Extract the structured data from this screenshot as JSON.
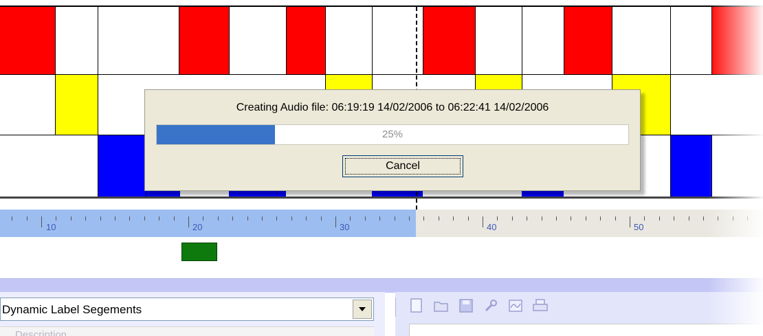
{
  "colors": {
    "red": "#ff0000",
    "yellow": "#ffff00",
    "blue": "#0000ff",
    "selection": "#9cbdf0",
    "progress": "#3974c8",
    "marker": "#0e7a0e"
  },
  "ruler": {
    "labels": [
      "10",
      "20",
      "30",
      "40",
      "50"
    ]
  },
  "dialog": {
    "message": "Creating Audio file:  06:19:19 14/02/2006 to 06:22:41 14/02/2006",
    "progress_fraction": 0.25,
    "progress_text": "25%",
    "cancel_label": "Cancel"
  },
  "segments_panel": {
    "dropdown_value": "Dynamic Label Segements",
    "column_header": "Description"
  },
  "toolbar": {
    "icons": [
      "new-document-icon",
      "open-folder-icon",
      "save-icon",
      "tools-icon",
      "chart-icon",
      "print-icon"
    ]
  }
}
